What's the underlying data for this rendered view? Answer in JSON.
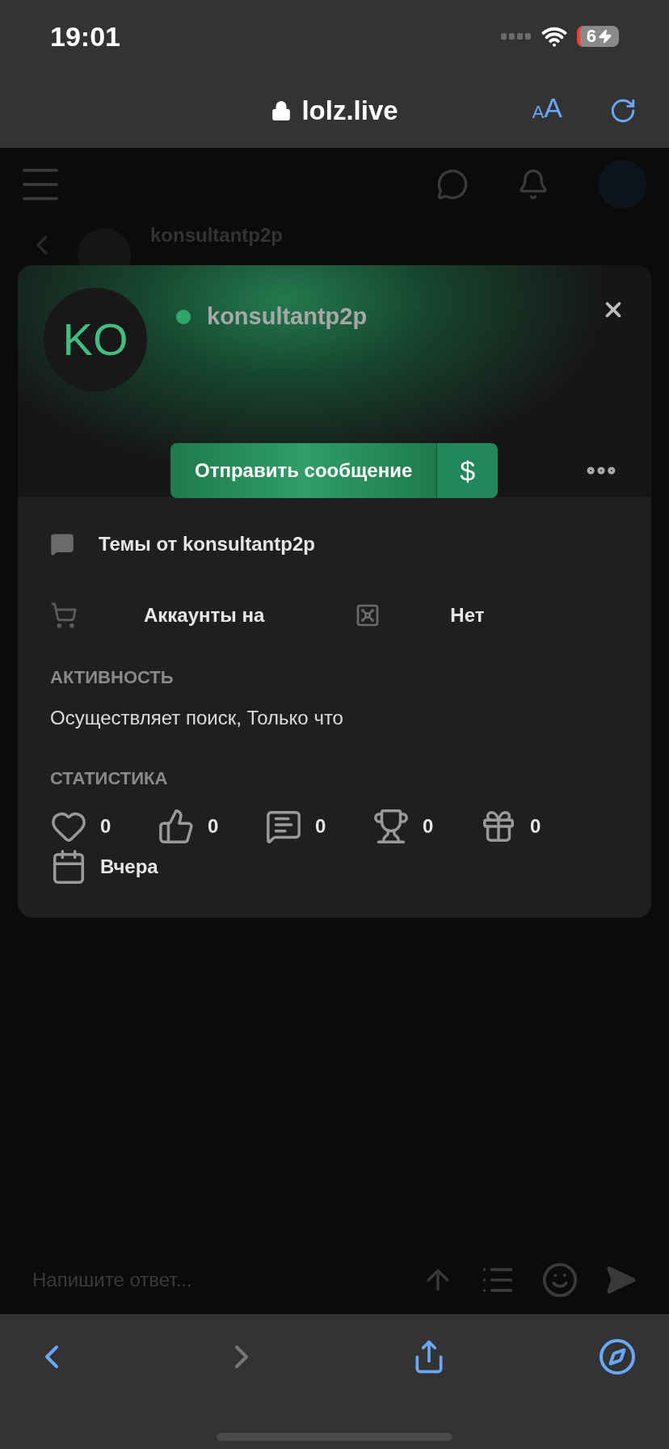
{
  "status_bar": {
    "time": "19:01",
    "battery_text": "6"
  },
  "browser": {
    "url": "lolz.live",
    "text_size_small": "A",
    "text_size_large": "A"
  },
  "background_thread": {
    "author": "konsultantp2p"
  },
  "profile_card": {
    "avatar_initials": "KO",
    "username": "konsultantp2p",
    "online": true,
    "send_button": "Отправить сообщение",
    "tip_button": "$",
    "links": [
      {
        "label": "Темы от konsultantp2p"
      }
    ],
    "accounts": {
      "label": "Аккаунты на",
      "value": "Нет"
    },
    "activity": {
      "heading": "АКТИВНОСТЬ",
      "text": "Осуществляет поиск, Только что"
    },
    "statistics": {
      "heading": "СТАТИСТИКА",
      "items": [
        {
          "kind": "likes",
          "value": "0"
        },
        {
          "kind": "reactions",
          "value": "0"
        },
        {
          "kind": "messages",
          "value": "0"
        },
        {
          "kind": "trophies",
          "value": "0"
        },
        {
          "kind": "gifts",
          "value": "0"
        }
      ],
      "registered": "Вчера"
    }
  },
  "reply_bar": {
    "placeholder": "Напишите ответ..."
  },
  "toolbar": {
    "back_disabled": false,
    "forward_disabled": true
  }
}
